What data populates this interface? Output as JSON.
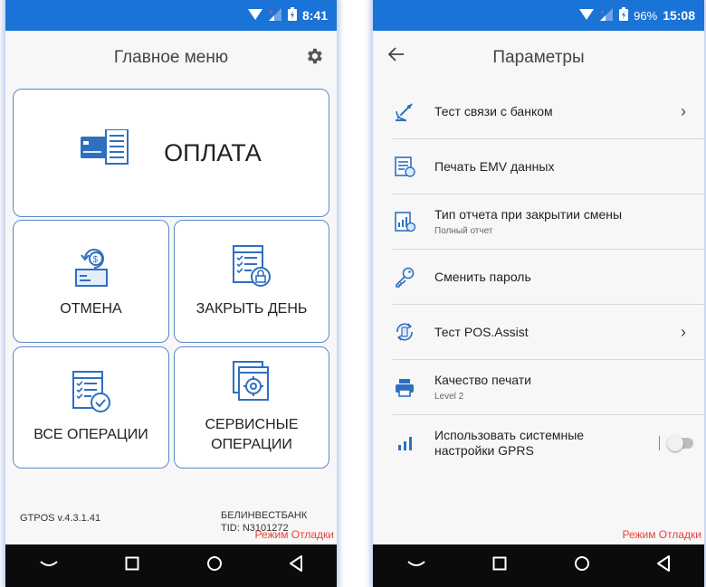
{
  "left_screen": {
    "status": {
      "time": "8:41"
    },
    "title": "Главное меню",
    "tiles": {
      "pay": "ОПЛАТА",
      "cancel": "ОТМЕНА",
      "close_day": "ЗАКРЫТЬ ДЕНЬ",
      "all_ops": "ВСЕ ОПЕРАЦИИ",
      "service_line1": "СЕРВИСНЫЕ",
      "service_line2": "ОПЕРАЦИИ"
    },
    "footer": {
      "version": "GTPOS v.4.3.1.41",
      "bank": "БЕЛИНВЕСТБАНК",
      "tid": "TID: N3101272"
    },
    "debug": "Режим Отладки"
  },
  "right_screen": {
    "status": {
      "battery": "96%",
      "time": "15:08"
    },
    "title": "Параметры",
    "items": [
      {
        "title": "Тест связи с банком",
        "icon": "satellite-dish-icon"
      },
      {
        "title": "Печать EMV данных",
        "icon": "receipt-list-icon"
      },
      {
        "title": "Тип отчета при закрытии смены",
        "subtitle": "Полный отчет",
        "icon": "report-chart-icon"
      },
      {
        "title": "Сменить пароль",
        "icon": "key-icon"
      },
      {
        "title": "Тест POS.Assist",
        "icon": "sync-terminal-icon"
      },
      {
        "title": "Качество печати",
        "subtitle": "Level 2",
        "icon": "printer-icon"
      },
      {
        "title_line1": "Использовать системные",
        "title_line2": "настройки GPRS",
        "icon": "signal-bars-icon"
      }
    ],
    "debug": "Режим Отладки"
  },
  "colors": {
    "status_bar": "#1a73d6",
    "tile_border": "#5b8ac4",
    "icon_blue": "#2f6fc0",
    "debug_text": "#e8413a",
    "navbar": "#0b0b0b"
  }
}
